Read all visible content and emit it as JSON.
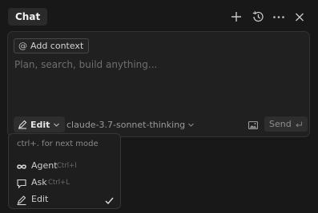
{
  "header": {
    "title": "Chat",
    "icons": [
      "plus-icon",
      "history-icon",
      "more-icon",
      "close-icon"
    ]
  },
  "composer": {
    "add_context_label": "Add context",
    "placeholder": "Plan, search, build anything...",
    "mode_label": "Edit",
    "model_label": "claude-3.7-sonnet-thinking",
    "send_label": "Send"
  },
  "mode_menu": {
    "hint": "ctrl+. for next mode",
    "items": [
      {
        "label": "Agent",
        "shortcut": "Ctrl+I",
        "icon": "infinity-icon",
        "selected": false
      },
      {
        "label": "Ask",
        "shortcut": "Ctrl+L",
        "icon": "chat-bubble-icon",
        "selected": false
      },
      {
        "label": "Edit",
        "shortcut": "",
        "icon": "pencil-icon",
        "selected": true
      }
    ]
  }
}
